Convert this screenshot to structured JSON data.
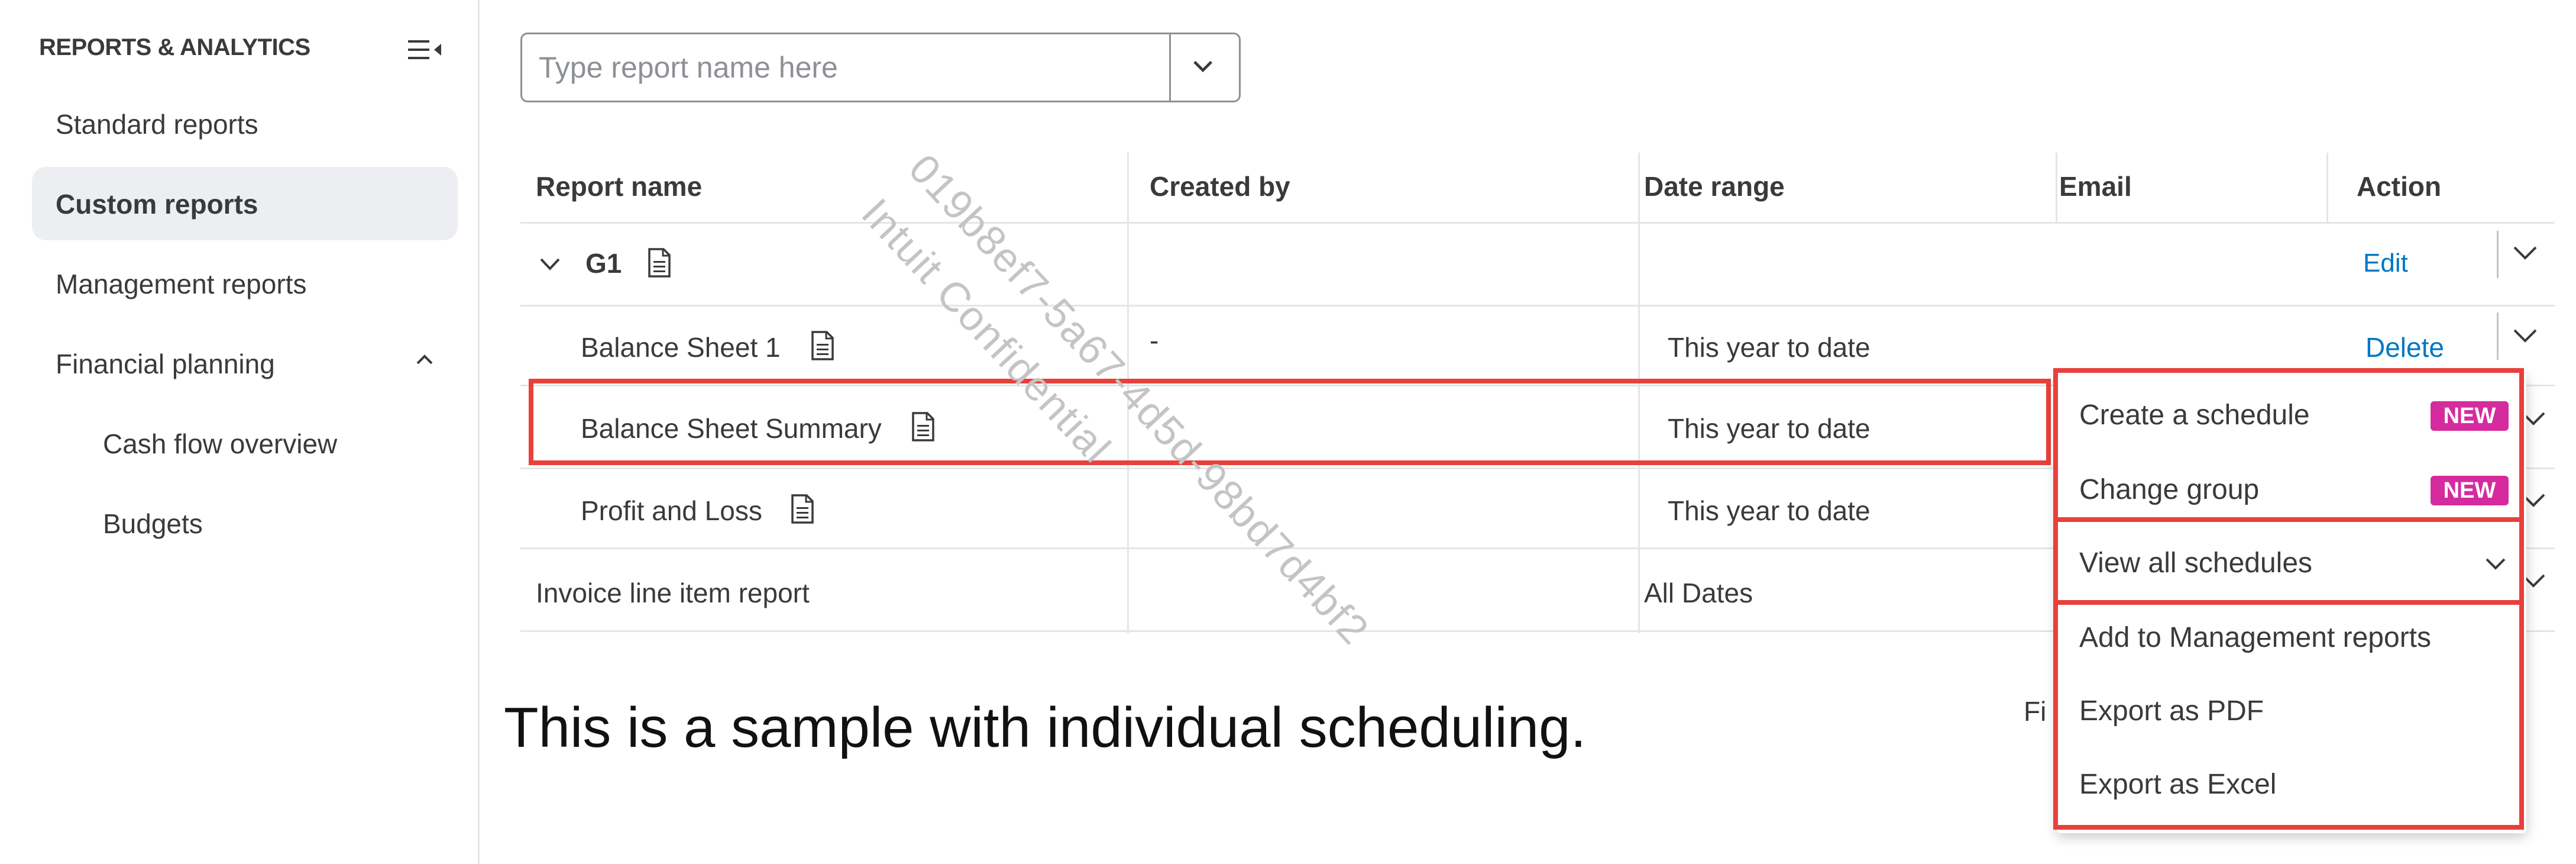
{
  "sidebar": {
    "heading": "REPORTS & ANALYTICS",
    "items": [
      {
        "label": "Standard reports"
      },
      {
        "label": "Custom reports"
      },
      {
        "label": "Management reports"
      },
      {
        "label": "Financial planning"
      },
      {
        "label": "Cash flow overview"
      },
      {
        "label": "Budgets"
      }
    ]
  },
  "search": {
    "placeholder": "Type report name here"
  },
  "table": {
    "headers": [
      "Report name",
      "Created by",
      "Date range",
      "Email",
      "Action"
    ],
    "rows": [
      {
        "name": "G1",
        "created_by": "",
        "date_range": "",
        "email": "",
        "action": "Edit"
      },
      {
        "name": "Balance Sheet 1",
        "created_by": "-",
        "date_range": "This year to date",
        "email": "",
        "action": "Delete"
      },
      {
        "name": "Balance Sheet Summary",
        "created_by": "",
        "date_range": "This year to date",
        "email": "",
        "action": ""
      },
      {
        "name": "Profit and Loss",
        "created_by": "",
        "date_range": "This year to date",
        "email": "",
        "action": ""
      },
      {
        "name": "Invoice line item report",
        "created_by": "",
        "date_range": "All Dates",
        "email": "",
        "action": ""
      }
    ]
  },
  "menu": {
    "items": [
      {
        "label": "Create a schedule",
        "badge": "NEW"
      },
      {
        "label": "Change group",
        "badge": "NEW"
      },
      {
        "label": "View all schedules"
      },
      {
        "label": "Add to Management reports"
      },
      {
        "label": "Export as PDF"
      },
      {
        "label": "Export as Excel"
      }
    ]
  },
  "caption": "This is a sample with individual scheduling.",
  "partial_text": "Fi",
  "watermark": {
    "line1": "019b8ef7-5a67-4d5d-98bd7d4bf2",
    "line2": "Intuit Confidential"
  },
  "colors": {
    "link": "#0077c5",
    "badge": "#d52b9e",
    "highlight": "#e8403a",
    "active_bg": "#eceef1"
  }
}
